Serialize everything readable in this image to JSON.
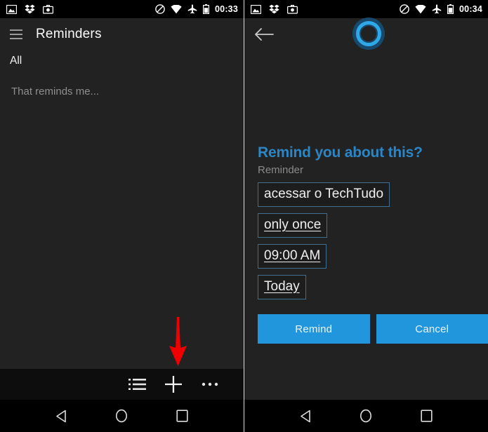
{
  "left_screen": {
    "statusbar": {
      "icons_left": [
        "photo-icon",
        "dropbox-icon",
        "camera-case-icon"
      ],
      "icons_right": [
        "do-not-disturb-icon",
        "wifi-icon",
        "airplane-mode-icon",
        "battery-icon"
      ],
      "time": "00:33"
    },
    "appbar": {
      "menu_icon": "hamburger-icon",
      "title": "Reminders"
    },
    "tabs": [
      {
        "label": "All"
      }
    ],
    "hint": "That reminds me...",
    "bottom_toolbar": [
      {
        "name": "list-view-button",
        "icon": "list-icon"
      },
      {
        "name": "add-reminder-button",
        "icon": "plus-icon"
      },
      {
        "name": "overflow-menu-button",
        "icon": "more-horizontal-icon"
      }
    ],
    "annotation": {
      "name": "red-arrow-pointer",
      "color": "#ee0000",
      "points_to": "add-reminder-button"
    }
  },
  "right_screen": {
    "statusbar": {
      "icons_left": [
        "photo-icon",
        "dropbox-icon",
        "camera-case-icon"
      ],
      "icons_right": [
        "do-not-disturb-icon",
        "wifi-icon",
        "airplane-mode-icon",
        "battery-icon"
      ],
      "time": "00:34"
    },
    "back_icon": "back-arrow-icon",
    "assistant_logo": "cortana-ring-icon",
    "heading": "Remind you about this?",
    "subheading": "Reminder",
    "fields": [
      {
        "name": "reminder-text-field",
        "value": "acessar o TechTudo",
        "underlined": false
      },
      {
        "name": "repeat-field",
        "value": "only once",
        "underlined": true
      },
      {
        "name": "time-field",
        "value": "09:00 AM",
        "underlined": true
      },
      {
        "name": "date-field",
        "value": "Today",
        "underlined": true
      }
    ],
    "buttons": {
      "confirm": "Remind",
      "cancel": "Cancel"
    }
  },
  "navbar": {
    "back": "back-triangle-icon",
    "home": "home-circle-icon",
    "recents": "recents-square-icon"
  },
  "colors": {
    "background": "#222222",
    "statusbar": "#000000",
    "accent_blue": "#2196dd",
    "heading_blue": "#2b86c5",
    "field_border": "#3e6f92",
    "arrow_red": "#ee0000",
    "toolbar": "#0d0d0d"
  }
}
